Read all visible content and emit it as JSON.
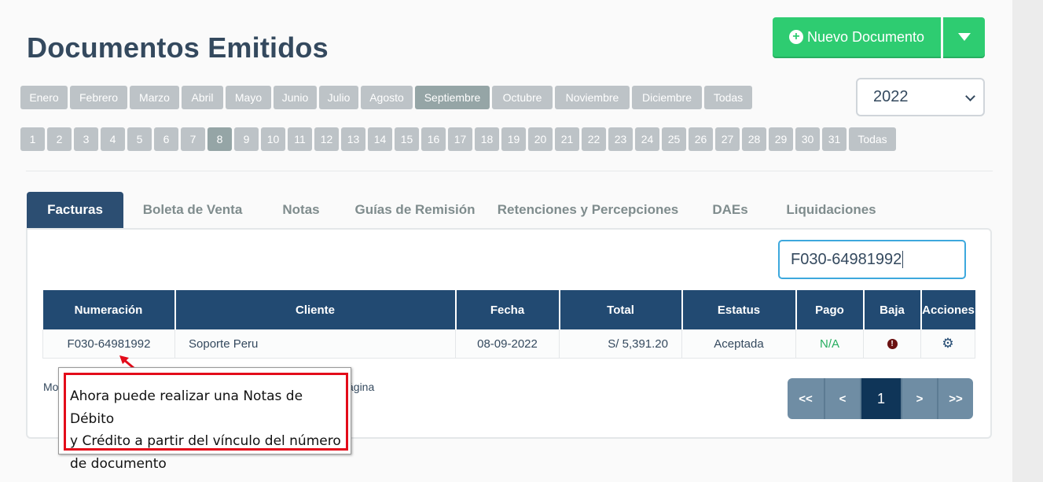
{
  "header": {
    "title": "Documentos Emitidos",
    "new_button": "Nuevo Documento",
    "year": "2022"
  },
  "months": [
    {
      "label": "Enero",
      "active": false
    },
    {
      "label": "Febrero",
      "active": false
    },
    {
      "label": "Marzo",
      "active": false
    },
    {
      "label": "Abril",
      "active": false
    },
    {
      "label": "Mayo",
      "active": false
    },
    {
      "label": "Junio",
      "active": false
    },
    {
      "label": "Julio",
      "active": false
    },
    {
      "label": "Agosto",
      "active": false
    },
    {
      "label": "Septiembre",
      "active": true
    },
    {
      "label": "Octubre",
      "active": false
    },
    {
      "label": "Noviembre",
      "active": false
    },
    {
      "label": "Diciembre",
      "active": false
    },
    {
      "label": "Todas",
      "active": false
    }
  ],
  "days": {
    "labels": [
      "1",
      "2",
      "3",
      "4",
      "5",
      "6",
      "7",
      "8",
      "9",
      "10",
      "11",
      "12",
      "13",
      "14",
      "15",
      "16",
      "17",
      "18",
      "19",
      "20",
      "21",
      "22",
      "23",
      "24",
      "25",
      "26",
      "27",
      "28",
      "29",
      "30",
      "31",
      "Todas"
    ],
    "active": "8"
  },
  "tabs": [
    {
      "label": "Facturas",
      "active": true
    },
    {
      "label": "Boleta de Venta",
      "active": false
    },
    {
      "label": "Notas",
      "active": false
    },
    {
      "label": "Guías de Remisión",
      "active": false
    },
    {
      "label": "Retenciones y Percepciones",
      "active": false
    },
    {
      "label": "DAEs",
      "active": false
    },
    {
      "label": "Liquidaciones",
      "active": false
    }
  ],
  "search": {
    "value": "F030-64981992"
  },
  "table": {
    "headers": [
      "Numeración",
      "Cliente",
      "Fecha",
      "Total",
      "Estatus",
      "Pago",
      "Baja",
      "Acciones"
    ],
    "rows": [
      {
        "numeracion": "F030-64981992",
        "cliente": "Soporte Peru",
        "fecha": "08-09-2022",
        "total": "S/ 5,391.20",
        "estatus": "Aceptada",
        "pago": "N/A",
        "baja_icon": "exclamation-circle-icon",
        "acciones_icon": "gear-icon"
      }
    ]
  },
  "footer": {
    "show_left": "Mo",
    "show_right": "ágina"
  },
  "pagination": {
    "first": "<<",
    "prev": "<",
    "current": "1",
    "next": ">",
    "last": ">>"
  },
  "tooltip": {
    "line1": "Ahora puede realizar una Notas de Débito",
    "line2": "y Crédito a partir del vínculo del número",
    "line3": "de documento"
  },
  "colors": {
    "accent_green": "#2ecc71",
    "header_navy": "#224a72",
    "link_blue": "#3a9ad9",
    "highlight_red": "#e30b1a"
  }
}
